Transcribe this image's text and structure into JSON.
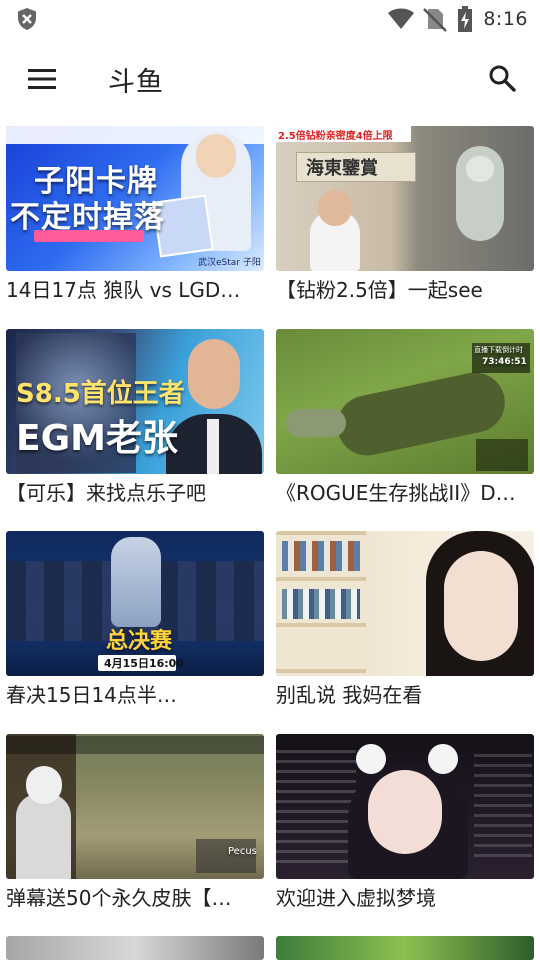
{
  "status_bar": {
    "time": "8:16",
    "icons": [
      "shield-icon",
      "wifi-icon",
      "no-sim-icon",
      "battery-charging-icon"
    ]
  },
  "app_bar": {
    "title": "斗鱼",
    "menu_icon": "menu-icon",
    "search_icon": "search-icon"
  },
  "streams": [
    {
      "caption": "14日17点 狼队 vs LGD…",
      "thumb_text_1": "子阳卡牌",
      "thumb_text_2": "不定时掉落",
      "thumb_text_3": "武汉eStar 子阳"
    },
    {
      "caption": "【钻粉2.5倍】一起see",
      "thumb_text_1": "2.5倍钻粉亲密度4倍上限",
      "thumb_text_2": "海東鑒賞"
    },
    {
      "caption": "【可乐】来找点乐子吧",
      "thumb_text_1": "S8.5首位王者",
      "thumb_text_2": "EGM老张"
    },
    {
      "caption": "《ROGUE生存挑战II》D…",
      "thumb_text_1": "直播下载倒计时",
      "thumb_text_2": "73:46:51"
    },
    {
      "caption": "春决15日14点半…",
      "thumb_text_1": "总决赛",
      "thumb_text_2": "4月15日16:00"
    },
    {
      "caption": "别乱说 我妈在看"
    },
    {
      "caption": "弹幕送50个永久皮肤【…",
      "thumb_text_1": "Pecus"
    },
    {
      "caption": "欢迎进入虚拟梦境"
    }
  ],
  "colors": {
    "background": "#ffffff",
    "text": "#222222"
  }
}
